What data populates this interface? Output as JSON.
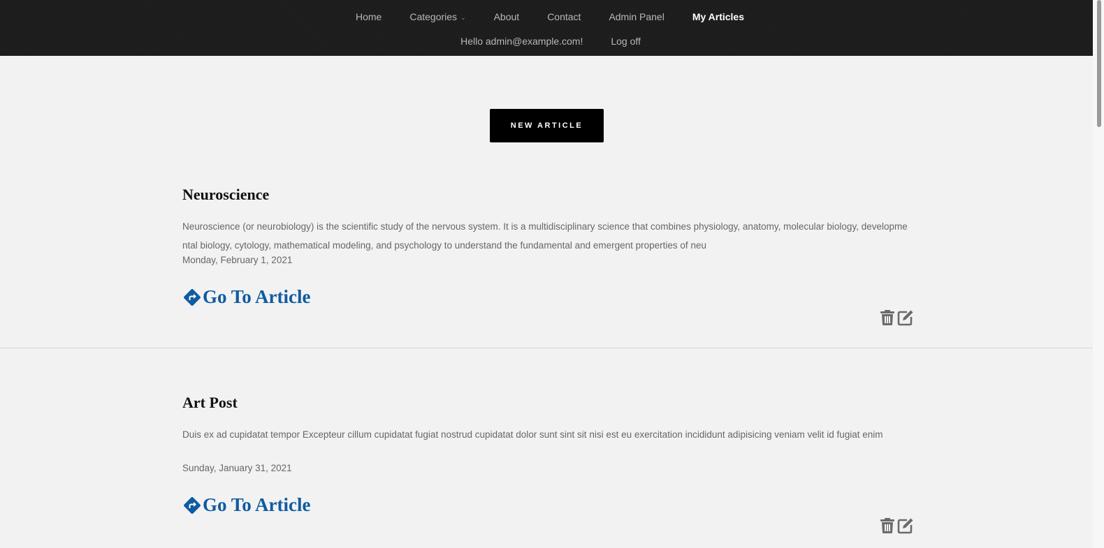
{
  "nav": {
    "row1": [
      {
        "label": "Home"
      },
      {
        "label": "Categories"
      },
      {
        "label": "About"
      },
      {
        "label": "Contact"
      },
      {
        "label": "Admin Panel"
      },
      {
        "label": "My Articles"
      }
    ],
    "greeting": "Hello admin@example.com!",
    "logoff": "Log off"
  },
  "new_article_label": "NEW ARTICLE",
  "articles": [
    {
      "title": "Neuroscience",
      "excerpt": "Neuroscience (or neurobiology) is the scientific study of the nervous system. It is a multidisciplinary science that combines physiology, anatomy, molecular biology, developmental biology, cytology, mathematical modeling, and psychology to understand the fundamental and emergent properties of neu",
      "date": "Monday, February 1, 2021",
      "link_label": "Go To Article"
    },
    {
      "title": "Art Post",
      "excerpt": "Duis ex ad cupidatat tempor Excepteur cillum cupidatat fugiat nostrud cupidatat dolor sunt sint sit nisi est eu exercitation incididunt adipisicing veniam velit id fugiat enim",
      "date": "Sunday, January 31, 2021",
      "link_label": "Go To Article"
    }
  ],
  "colors": {
    "nav_bg": "#1c1c1c",
    "page_bg": "#f2f2f2",
    "link_blue": "#0f5ba0",
    "icon_gray": "#6b6b6b"
  },
  "icons": {
    "goto": "share-square-icon",
    "delete": "trash-icon",
    "edit": "edit-icon",
    "dropdown": "chevron-down-icon"
  }
}
